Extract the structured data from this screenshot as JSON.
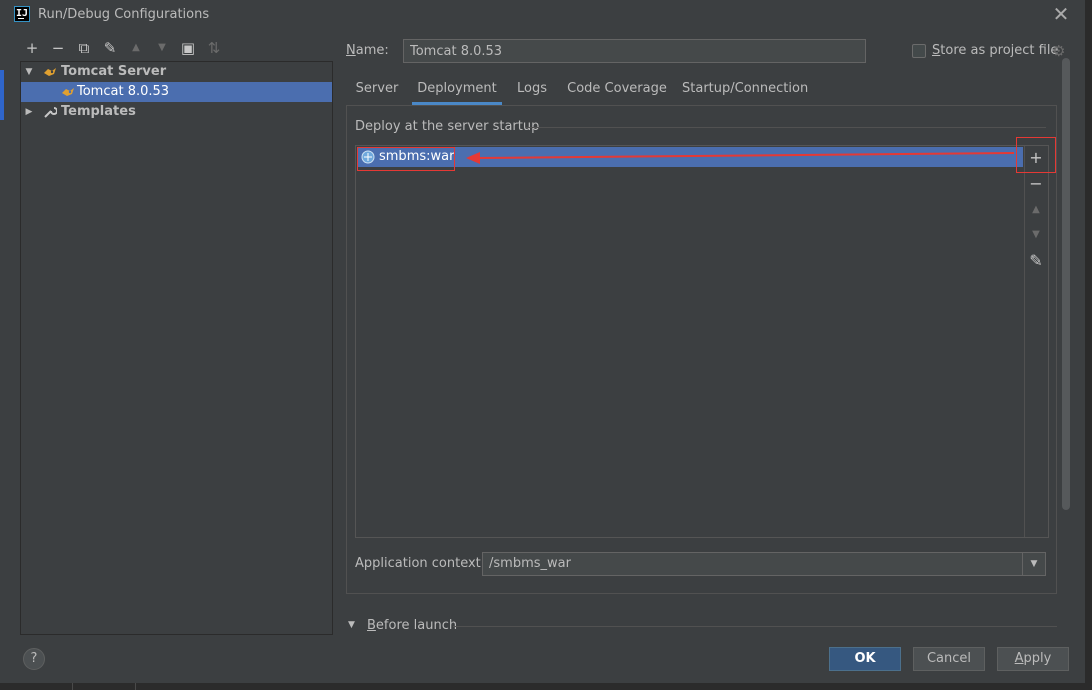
{
  "window": {
    "title": "Run/Debug Configurations",
    "app_icon_text": "IJ"
  },
  "toolbar": {
    "add": "+",
    "remove": "−",
    "copy": "⧉",
    "edit": "✎",
    "move_up": "▲",
    "move_down": "▼",
    "folder": "▣",
    "sort": "⇅"
  },
  "tree": {
    "groups": [
      {
        "label": "Tomcat Server",
        "expanded": true,
        "children": [
          {
            "label": "Tomcat 8.0.53",
            "selected": true
          }
        ]
      },
      {
        "label": "Templates",
        "expanded": false
      }
    ]
  },
  "form": {
    "name_label_prefix": "N",
    "name_label_rest": "ame:",
    "name_value": "Tomcat 8.0.53",
    "store_label_prefix": "S",
    "store_label_rest": "tore as project file",
    "store_checked": false
  },
  "tabs": [
    {
      "label": "Server"
    },
    {
      "label": "Deployment",
      "active": true
    },
    {
      "label": "Logs"
    },
    {
      "label": "Code Coverage"
    },
    {
      "label": "Startup/Connection"
    }
  ],
  "deployment": {
    "section_title": "Deploy at the server startup",
    "items": [
      {
        "label": "smbms:war",
        "selected": true
      }
    ],
    "side_buttons": {
      "add": "+",
      "remove": "−",
      "up": "▲",
      "down": "▼",
      "edit": "✎"
    },
    "context_label": "Application context:",
    "context_value": "/smbms_war"
  },
  "before_launch": {
    "label_prefix": "B",
    "label_rest": "efore launch"
  },
  "buttons": {
    "help": "?",
    "ok": "OK",
    "cancel": "Cancel",
    "apply_prefix": "A",
    "apply_rest": "pply"
  },
  "colors": {
    "selection": "#4b6eaf",
    "annotation": "#e53935",
    "ok_button": "#365880"
  }
}
